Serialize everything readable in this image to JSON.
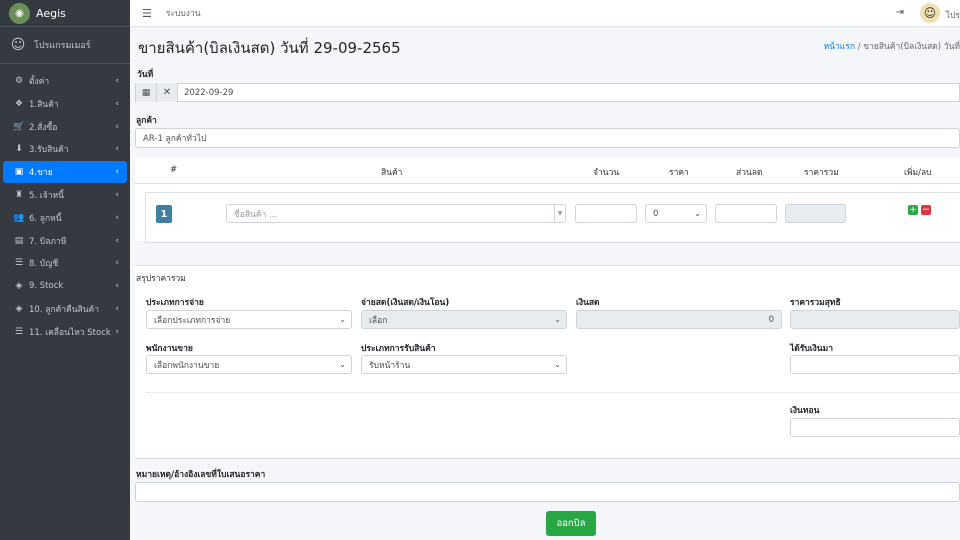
{
  "sidebar": {
    "brand": "Aegis",
    "user": "โปรแกรมเมอร์",
    "items": [
      {
        "label": "ตั้งค่า",
        "icon": "cogs-icon"
      },
      {
        "label": "1.สินค้า",
        "icon": "cubes-icon"
      },
      {
        "label": "2.สั่งซื้อ",
        "icon": "cart-icon"
      },
      {
        "label": "3.รับสินค้า",
        "icon": "download-icon"
      },
      {
        "label": "4.ขาย",
        "icon": "cash-register-icon"
      },
      {
        "label": "5. เจ้าหนี้",
        "icon": "user-lock-icon"
      },
      {
        "label": "6. ลูกหนี้",
        "icon": "users-icon"
      },
      {
        "label": "7. บิลภาษี",
        "icon": "file-icon"
      },
      {
        "label": "8. บัญชี",
        "icon": "list-icon"
      },
      {
        "label": "9. Stock",
        "icon": "box-icon"
      },
      {
        "label": "10. ลูกค้าคืนสินค้า",
        "icon": "box-return-icon"
      },
      {
        "label": "11. เคลื่อนไหว Stock",
        "icon": "list-icon"
      }
    ],
    "active_index": 4
  },
  "topbar": {
    "system_label": "ระบบงาน",
    "user_short": "โปร"
  },
  "page": {
    "title": "ขายสินค้า(บิลเงินสด) วันที่ 29-09-2565",
    "breadcrumb_home": "หน้าแรก",
    "breadcrumb_sep": "/",
    "breadcrumb_current": "ขายสินค้า(บิลเงินสด) วันที่"
  },
  "date_section": {
    "label": "วันที่",
    "value": "2022-09-29"
  },
  "customer_section": {
    "label": "ลูกค้า",
    "value": "AR-1 ลูกค้าทั่วไป"
  },
  "items_table": {
    "headers": [
      "#",
      "สินค้า",
      "จำนวน",
      "ราคา",
      "ส่วนลด",
      "ราคารวม",
      "เพิ่ม/ลบ"
    ],
    "row_number": "1",
    "product_placeholder": "ชื่อสินค้า ...",
    "price_value": "0",
    "add_symbol": "+",
    "remove_symbol": "−"
  },
  "summary": {
    "title": "สรุปราคารวม",
    "payment_type_label": "ประเภทการจ่าย",
    "payment_type_value": "เลือกประเภทการจ่าย",
    "pay_method_label": "จ่ายสด(เงินสด/เงินโอน)",
    "pay_method_value": "เลือก",
    "cash_label": "เงินสด",
    "cash_value": "0",
    "net_total_label": "ราคารวมสุทธิ",
    "salesperson_label": "พนักงานขาย",
    "salesperson_value": "เลือกพนักงานขาย",
    "receive_type_label": "ประเภทการรับสินค้า",
    "receive_type_value": "รับหน้าร้าน",
    "received_label": "ได้รับเงินมา",
    "change_label": "เงินทอน"
  },
  "remark": {
    "label": "หมายเหตุ/อ้างอิงเลขที่ใบเสนอราคา"
  },
  "submit_label": "ออกบิล"
}
